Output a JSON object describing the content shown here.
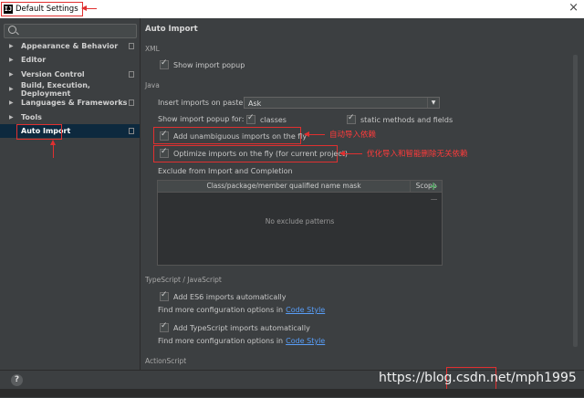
{
  "window": {
    "title": "Default Settings",
    "app_icon": "IJ",
    "close_glyph": "×"
  },
  "sidebar": {
    "search": {
      "placeholder": ""
    },
    "items": [
      {
        "label": "Appearance & Behavior"
      },
      {
        "label": "Editor"
      },
      {
        "label": "Version Control"
      },
      {
        "label": "Build, Execution, Deployment"
      },
      {
        "label": "Languages & Frameworks"
      },
      {
        "label": "Tools"
      },
      {
        "label": "Auto Import",
        "selected": true
      }
    ]
  },
  "main": {
    "heading": "Auto Import",
    "xml": {
      "section": "XML",
      "show_popup": {
        "label": "Show import popup",
        "checked": true
      }
    },
    "java": {
      "section": "Java",
      "insert_label": "Insert imports on paste:",
      "insert_value": "Ask",
      "popup_for_label": "Show import popup for:",
      "classes": {
        "label": "classes",
        "checked": true
      },
      "static_methods": {
        "label": "static methods and fields",
        "checked": true
      },
      "add_unambiguous": {
        "label": "Add unambiguous imports on the fly",
        "checked": true
      },
      "optimize": {
        "label": "Optimize imports on the fly (for current project)",
        "checked": true
      },
      "exclude_section": "Exclude from Import and Completion",
      "table": {
        "col1": "Class/package/member qualified name mask",
        "col2": "Scope",
        "empty": "No exclude patterns"
      },
      "add_button": "+",
      "remove_button": "−"
    },
    "ts": {
      "section": "TypeScript / JavaScript",
      "es6": {
        "label": "Add ES6 imports automatically",
        "checked": true
      },
      "es6_more": "Find more configuration options in",
      "es6_link": "Code Style",
      "ts_add": {
        "label": "Add TypeScript imports automatically",
        "checked": true
      },
      "ts_more": "Find more configuration options in",
      "ts_link": "Code Style"
    },
    "actionscript_section": "ActionScript"
  },
  "annotations": {
    "note1": "自动导入依赖",
    "note2": "优化导入和智能删除无关依赖"
  },
  "bottom": {
    "help": "?",
    "watermark": "https://blog.csdn.net/mph1995"
  },
  "colors": {
    "accent_red": "#e03030",
    "link": "#589df6",
    "selection": "#0d293e"
  }
}
